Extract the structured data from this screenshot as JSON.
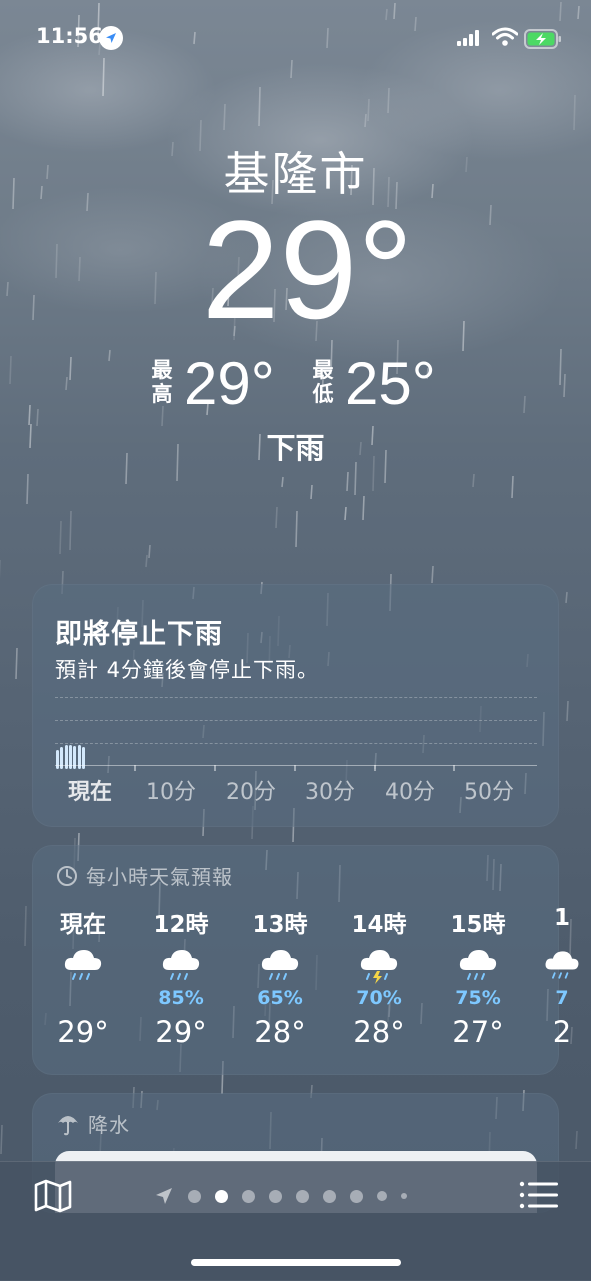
{
  "status": {
    "time": "11:56"
  },
  "header": {
    "city": "基隆市",
    "temp": "29°",
    "high_label": "最高",
    "high": "29°",
    "low_label": "最低",
    "low": "25°",
    "condition": "下雨"
  },
  "precip_alert": {
    "title": "即將停止下雨",
    "subtitle": "預計 4分鐘後會停止下雨。",
    "time_labels": [
      "現在",
      "10分",
      "20分",
      "30分",
      "40分",
      "50分"
    ],
    "intensity": [
      0.8,
      0.9,
      1.0,
      1.0,
      0.95,
      1.0,
      0.9
    ]
  },
  "hourly": {
    "title": "每小時天氣預報",
    "hours": [
      {
        "label": "現在",
        "icon": "cloud-rain-icon",
        "chance": "",
        "temp": "29°"
      },
      {
        "label": "12時",
        "icon": "cloud-rain-icon",
        "chance": "85%",
        "temp": "29°"
      },
      {
        "label": "13時",
        "icon": "cloud-rain-icon",
        "chance": "65%",
        "temp": "28°"
      },
      {
        "label": "14時",
        "icon": "cloud-bolt-rain-icon",
        "chance": "70%",
        "temp": "28°"
      },
      {
        "label": "15時",
        "icon": "cloud-rain-icon",
        "chance": "75%",
        "temp": "27°"
      },
      {
        "label": "1",
        "icon": "cloud-rain-icon",
        "chance": "7",
        "temp": "2"
      }
    ]
  },
  "precipitation": {
    "title": "降水"
  },
  "tabbar": {
    "page_count": 9,
    "active_page": 2
  },
  "colors": {
    "accent": "#7ec8ff",
    "card": "#5a6e82",
    "background": "#566474"
  }
}
